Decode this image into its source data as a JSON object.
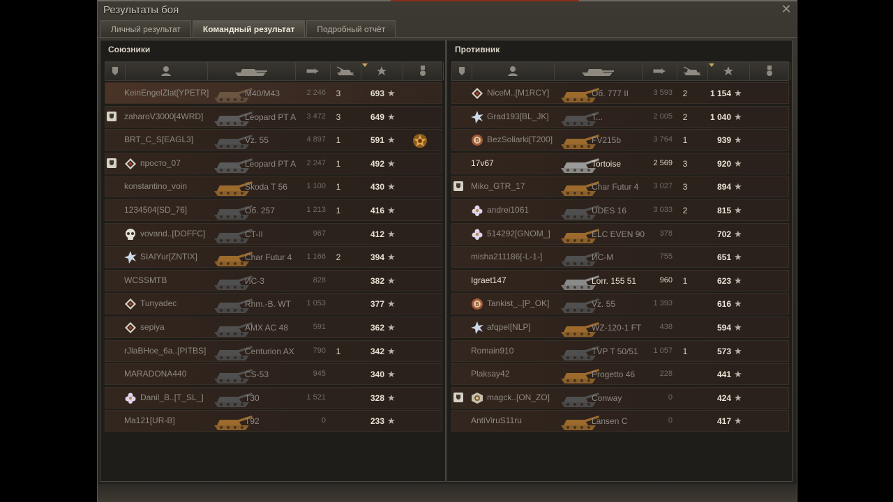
{
  "window": {
    "title": "Результаты боя",
    "close_icon": "close-icon"
  },
  "tabs": [
    {
      "label": "Личный результат",
      "active": false
    },
    {
      "label": "Командный результат",
      "active": true
    },
    {
      "label": "Подробный отчёт",
      "active": false
    }
  ],
  "allies": {
    "title": "Союзники",
    "rows": [
      {
        "player": "KeinEngelZlat[YPETR]",
        "tank": "M40/M43",
        "damage": "2 246",
        "frags": "3",
        "xp": "693",
        "me": true,
        "tank_tier_color": "#6b5440",
        "rank": "",
        "platoon": false,
        "medal": false
      },
      {
        "player": "zaharoV3000[4WRD]",
        "tank": "Leopard PT A",
        "damage": "3 472",
        "frags": "3",
        "xp": "649",
        "me": false,
        "tank_tier_color": "#5a5a5a",
        "rank": "",
        "platoon": true,
        "medal": false
      },
      {
        "player": "BRT_C_S[EAGL3]",
        "tank": "Vz. 55",
        "damage": "4 897",
        "frags": "1",
        "xp": "591",
        "me": false,
        "tank_tier_color": "#4f4f4f",
        "rank": "",
        "platoon": false,
        "medal": true
      },
      {
        "player": "просто_07",
        "tank": "Leopard PT A",
        "damage": "2 247",
        "frags": "1",
        "xp": "492",
        "me": false,
        "tank_tier_color": "#5a5a5a",
        "rank": "diamond",
        "platoon": true,
        "medal": false
      },
      {
        "player": "konstantino_voin",
        "tank": "Škoda T 56",
        "damage": "1 100",
        "frags": "1",
        "xp": "430",
        "me": false,
        "tank_tier_color": "#9b6a2c",
        "rank": "",
        "platoon": false,
        "medal": false
      },
      {
        "player": "1234504[SD_76]",
        "tank": "Об. 257",
        "damage": "1 213",
        "frags": "1",
        "xp": "416",
        "me": false,
        "tank_tier_color": "#4f4f4f",
        "rank": "",
        "platoon": false,
        "medal": false
      },
      {
        "player": "vovand..[DOFFC]",
        "tank": "CT-II",
        "damage": "967",
        "frags": "",
        "xp": "412",
        "me": false,
        "tank_tier_color": "#4f4f4f",
        "rank": "skull",
        "platoon": false,
        "medal": false
      },
      {
        "player": "SIAIYur[ZNTIX]",
        "tank": "Char Futur 4",
        "damage": "1 166",
        "frags": "2",
        "xp": "394",
        "me": false,
        "tank_tier_color": "#9b6a2c",
        "rank": "star",
        "platoon": false,
        "medal": false
      },
      {
        "player": "WCSSMTB",
        "tank": "ИС-3",
        "damage": "828",
        "frags": "",
        "xp": "382",
        "me": false,
        "tank_tier_color": "#4f4f4f",
        "rank": "",
        "platoon": false,
        "medal": false
      },
      {
        "player": "Tunyadec",
        "tank": "Rhm.-B. WT",
        "damage": "1 053",
        "frags": "",
        "xp": "377",
        "me": false,
        "tank_tier_color": "#4f4f4f",
        "rank": "diamond",
        "platoon": false,
        "medal": false
      },
      {
        "player": "sepiya",
        "tank": "AMX AC 48",
        "damage": "591",
        "frags": "",
        "xp": "362",
        "me": false,
        "tank_tier_color": "#4f4f4f",
        "rank": "diamond",
        "platoon": false,
        "medal": false
      },
      {
        "player": "rJlaBHoe_6a..[PITBS]",
        "tank": "Centurion AX",
        "damage": "790",
        "frags": "1",
        "xp": "342",
        "me": false,
        "tank_tier_color": "#4f4f4f",
        "rank": "",
        "platoon": false,
        "medal": false
      },
      {
        "player": "MARADONA440",
        "tank": "CS-53",
        "damage": "945",
        "frags": "",
        "xp": "340",
        "me": false,
        "tank_tier_color": "#4f4f4f",
        "rank": "",
        "platoon": false,
        "medal": false
      },
      {
        "player": "Danil_B..[T_SL_]",
        "tank": "T30",
        "damage": "1 521",
        "frags": "",
        "xp": "328",
        "me": false,
        "tank_tier_color": "#4f4f4f",
        "rank": "flower",
        "platoon": false,
        "medal": false
      },
      {
        "player": "Ma121[UR-B]",
        "tank": "T92",
        "damage": "0",
        "frags": "",
        "xp": "233",
        "me": false,
        "tank_tier_color": "#9b6a2c",
        "rank": "",
        "platoon": false,
        "medal": false
      }
    ]
  },
  "enemies": {
    "title": "Противник",
    "rows": [
      {
        "player": "NiceM..[M1RCY]",
        "tank": "Об. 777 II",
        "damage": "3 593",
        "frags": "2",
        "xp": "1 154",
        "bright": false,
        "tank_tier_color": "#9b6a2c",
        "rank": "diamond",
        "platoon": false
      },
      {
        "player": "Grad193[BL_JK]",
        "tank": "T...",
        "damage": "2 005",
        "frags": "2",
        "xp": "1 040",
        "bright": false,
        "tank_tier_color": "#4f4f4f",
        "rank": "star",
        "platoon": false
      },
      {
        "player": "BezSoliarki[T200]",
        "tank": "FV215b",
        "damage": "3 764",
        "frags": "1",
        "xp": "939",
        "bright": false,
        "tank_tier_color": "#9b6a2c",
        "rank": "badge",
        "platoon": false
      },
      {
        "player": "17v67",
        "tank": "Tortoise",
        "damage": "2 569",
        "frags": "3",
        "xp": "920",
        "bright": true,
        "tank_tier_color": "#9a9a9a",
        "rank": "",
        "platoon": false
      },
      {
        "player": "Miko_GTR_17",
        "tank": "Char Futur 4",
        "damage": "3 027",
        "frags": "3",
        "xp": "894",
        "bright": false,
        "tank_tier_color": "#9b6a2c",
        "rank": "",
        "platoon": true
      },
      {
        "player": "andrei1061",
        "tank": "UDES 16",
        "damage": "3 033",
        "frags": "2",
        "xp": "815",
        "bright": false,
        "tank_tier_color": "#4f4f4f",
        "rank": "flower",
        "platoon": false
      },
      {
        "player": "514292[GNOM_]",
        "tank": "ELC EVEN 90",
        "damage": "378",
        "frags": "",
        "xp": "702",
        "bright": false,
        "tank_tier_color": "#9b6a2c",
        "rank": "flower",
        "platoon": false
      },
      {
        "player": "misha211186[-L-1-]",
        "tank": "ИС-М",
        "damage": "755",
        "frags": "",
        "xp": "651",
        "bright": false,
        "tank_tier_color": "#4f4f4f",
        "rank": "",
        "platoon": false
      },
      {
        "player": "Igraet147",
        "tank": "Lorr. 155 51",
        "damage": "960",
        "frags": "1",
        "xp": "623",
        "bright": true,
        "tank_tier_color": "#8a8a8a",
        "rank": "",
        "platoon": false
      },
      {
        "player": "Tankist_..[P_OK]",
        "tank": "Vz. 55",
        "damage": "1 393",
        "frags": "",
        "xp": "616",
        "bright": false,
        "tank_tier_color": "#4f4f4f",
        "rank": "badge",
        "platoon": false
      },
      {
        "player": "afqpel[NLP]",
        "tank": "WZ-120-1 FT",
        "damage": "438",
        "frags": "",
        "xp": "594",
        "bright": false,
        "tank_tier_color": "#9b6a2c",
        "rank": "star",
        "platoon": false
      },
      {
        "player": "Romain910",
        "tank": "TVP T 50/51",
        "damage": "1 057",
        "frags": "1",
        "xp": "573",
        "bright": false,
        "tank_tier_color": "#4f4f4f",
        "rank": "",
        "platoon": false
      },
      {
        "player": "Plaksay42",
        "tank": "Progetto 46",
        "damage": "228",
        "frags": "",
        "xp": "441",
        "bright": false,
        "tank_tier_color": "#9b6a2c",
        "rank": "",
        "platoon": false
      },
      {
        "player": "magck..[ON_ZO]",
        "tank": "Conway",
        "damage": "0",
        "frags": "",
        "xp": "424",
        "bright": false,
        "tank_tier_color": "#4f4f4f",
        "rank": "emblem",
        "platoon": true
      },
      {
        "player": "AntiViruS11ru",
        "tank": "Lansen C",
        "damage": "0",
        "frags": "",
        "xp": "417",
        "bright": false,
        "tank_tier_color": "#9b6a2c",
        "rank": "",
        "platoon": false
      }
    ]
  },
  "columns": {
    "squad_icon": "squad-icon",
    "player_icon": "player-icon",
    "tank_icon": "tank-icon",
    "damage_icon": "damage-icon",
    "frags_icon": "frags-icon",
    "xp_icon": "xp-star-icon",
    "medal_icon": "medal-icon"
  },
  "colors": {
    "accent": "#c9a75a",
    "row_bg": "#2d221c",
    "text_bright": "#e6e0d2",
    "text_dim": "#8e8982"
  }
}
